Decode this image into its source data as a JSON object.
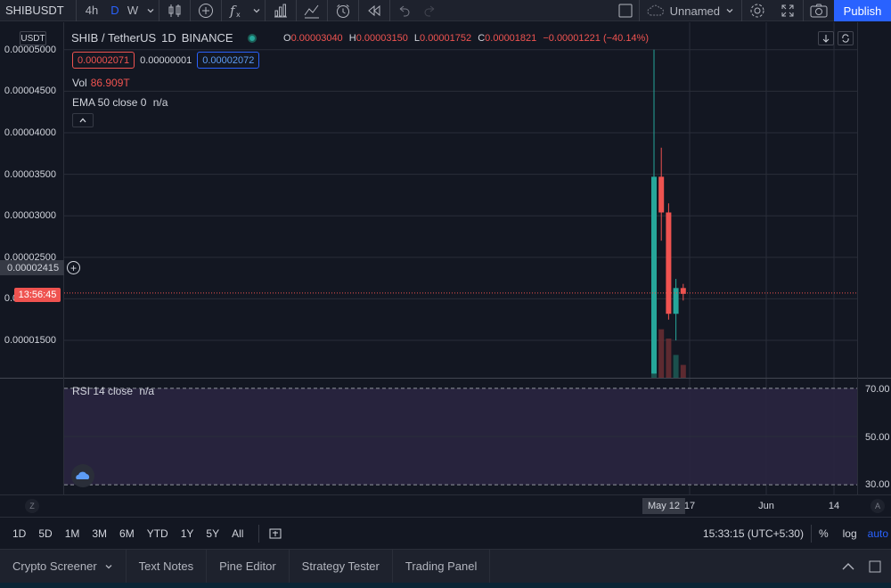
{
  "toolbar": {
    "symbol": "SHIBUSDT",
    "intervals": [
      "4h",
      "D",
      "W"
    ],
    "active_interval": "D",
    "layout_name": "Unnamed",
    "publish_label": "Publish"
  },
  "legend": {
    "currency": "USDT",
    "title": "SHIB / TetherUS",
    "interval": "1D",
    "exchange": "BINANCE",
    "o_label": "O",
    "o_value": "0.00003040",
    "h_label": "H",
    "h_value": "0.00003150",
    "l_label": "L",
    "l_value": "0.00001752",
    "c_label": "C",
    "c_value": "0.00001821",
    "change": "−0.00001221 (−40.14%)",
    "sell_price": "0.00002071",
    "spread": "0.00000001",
    "buy_price": "0.00002072",
    "volume_label": "Vol",
    "volume_value": "86.909T",
    "ema_label": "EMA 50 close 0",
    "ema_value": "n/a",
    "rsi_label": "RSI 14 close",
    "rsi_value": "n/a"
  },
  "price_scale": {
    "ticks": [
      "0.00005000",
      "0.00004500",
      "0.00004000",
      "0.00003500",
      "0.00003000",
      "0.00002500",
      "0.00002000",
      "0.00001500"
    ],
    "crosshair_price": "0.00002415",
    "countdown": "13:56:45"
  },
  "rsi_scale": {
    "ticks": [
      "70.00",
      "50.00",
      "30.00"
    ]
  },
  "time_axis": {
    "labels": [
      "17",
      "Jun",
      "14"
    ],
    "active_label": "May 12",
    "left_corner": "Z",
    "right_corner": "A"
  },
  "range_bar": {
    "ranges": [
      "1D",
      "5D",
      "1M",
      "3M",
      "6M",
      "YTD",
      "1Y",
      "5Y",
      "All"
    ],
    "clock": "15:33:15 (UTC+5:30)",
    "percent_label": "%",
    "log_label": "log",
    "auto_label": "auto"
  },
  "bottom_tabs": [
    "Crypto Screener",
    "Text Notes",
    "Pine Editor",
    "Strategy Tester",
    "Trading Panel"
  ],
  "colors": {
    "background": "#131722",
    "up": "#26a69a",
    "down": "#ef5350",
    "accent": "#2962ff",
    "rsi_band": "#2a2540"
  },
  "chart_data": {
    "type": "candlestick",
    "y_range": [
      1.05e-05,
      5.33e-05
    ],
    "y_ticks": [
      5e-05,
      4.5e-05,
      4e-05,
      3.5e-05,
      3e-05,
      2.5e-05,
      2e-05,
      1.5e-05
    ],
    "last_price": 2.071e-05,
    "crosshair_price": 2.415e-05,
    "candles": [
      {
        "o": 1.1e-05,
        "h": 5e-05,
        "l": 1.1e-05,
        "c": 3.47e-05,
        "vol": 0.9,
        "dir": "up"
      },
      {
        "o": 3.47e-05,
        "h": 3.82e-05,
        "l": 2.7e-05,
        "c": 3.04e-05,
        "vol": 0.68,
        "dir": "down"
      },
      {
        "o": 3.04e-05,
        "h": 3.15e-05,
        "l": 1.75e-05,
        "c": 1.82e-05,
        "vol": 0.55,
        "dir": "down"
      },
      {
        "o": 1.82e-05,
        "h": 2.24e-05,
        "l": 1.5e-05,
        "c": 2.13e-05,
        "vol": 0.32,
        "dir": "up"
      },
      {
        "o": 2.13e-05,
        "h": 2.18e-05,
        "l": 1.98e-05,
        "c": 2.06e-05,
        "vol": 0.18,
        "dir": "down"
      }
    ],
    "rsi_bands": [
      70,
      50,
      30
    ],
    "rsi_range": [
      26,
      74
    ]
  }
}
